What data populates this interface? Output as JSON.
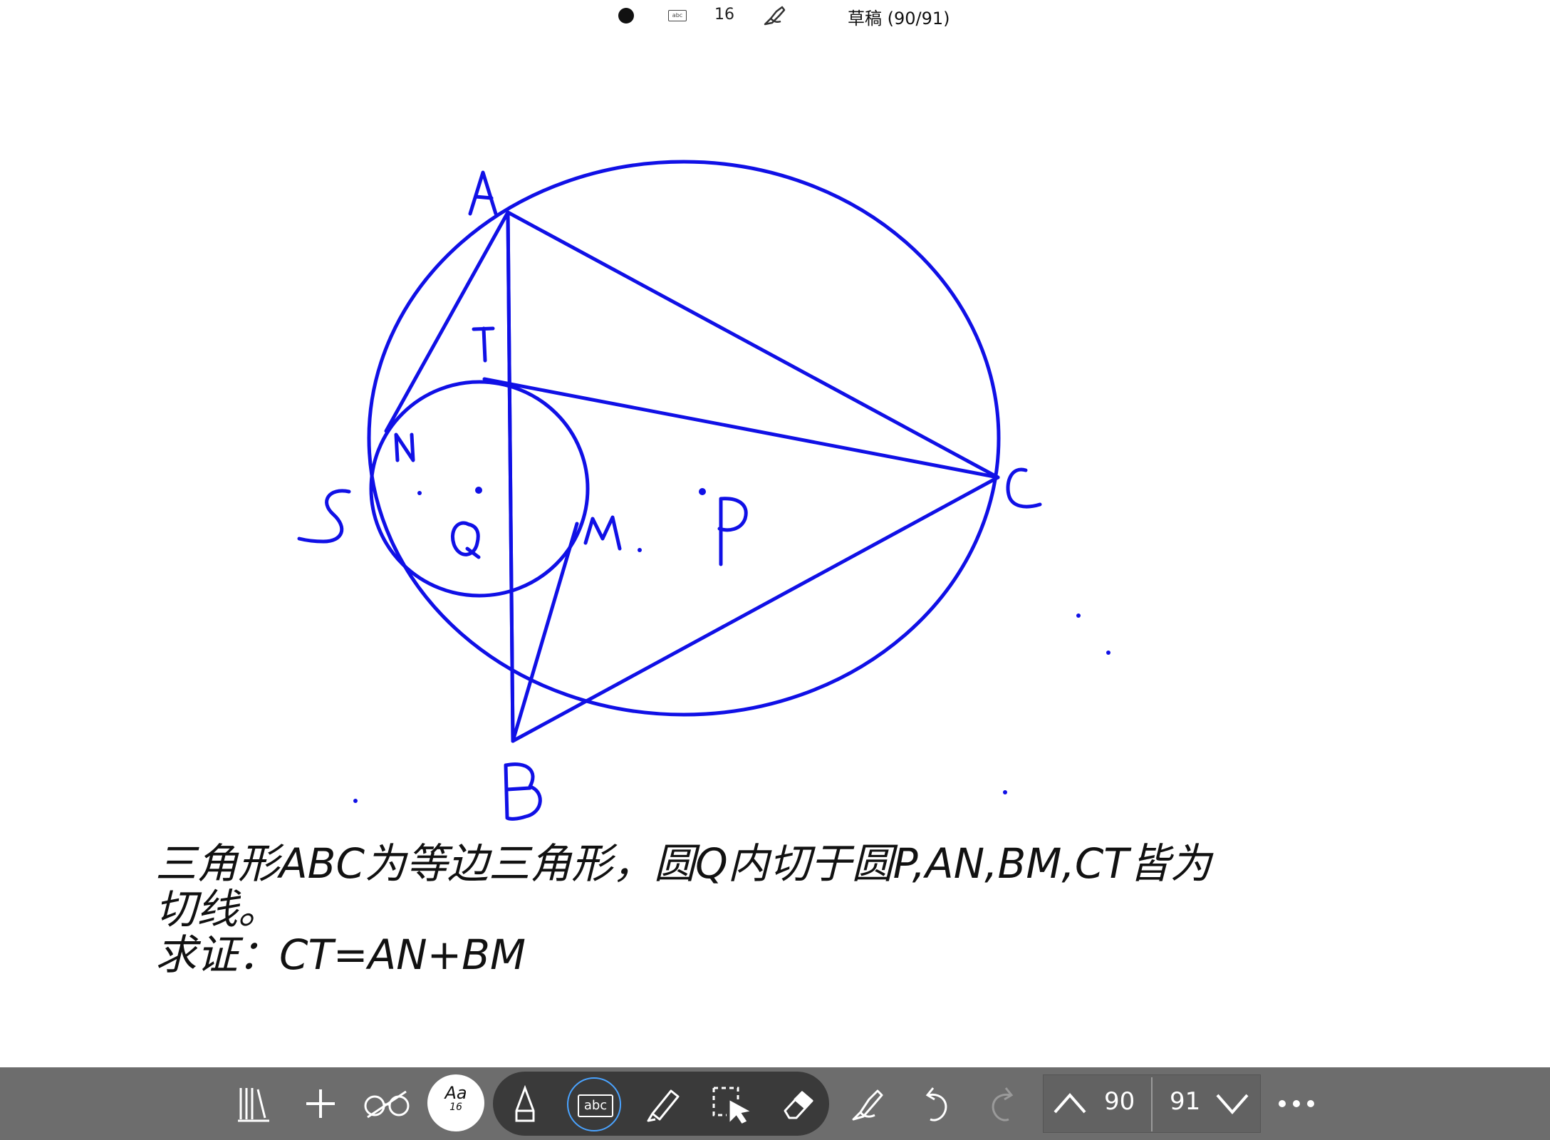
{
  "status_bar": {
    "font_size": "16",
    "title": "草稿 (90/91)"
  },
  "figure": {
    "labels": {
      "A": "A",
      "B": "B",
      "C": "C",
      "T": "T",
      "N": "N",
      "S": "S",
      "Q": "Q",
      "M": "M.",
      "P": "P"
    },
    "stroke_color": "#1010e6"
  },
  "problem": {
    "line1": "三角形ABC为等边三角形，圆Q内切于圆P,AN,BM,CT皆为",
    "line2": "切线。",
    "line3": "求证：CT=AN+BM"
  },
  "toolbar": {
    "font_button_label": "Aa",
    "font_button_size": "16",
    "text_tool_label": "abc",
    "current_page": "90",
    "total_page": "91",
    "icons": [
      "library-icon",
      "add-icon",
      "view-icon",
      "font-icon",
      "pen-icon",
      "text-icon",
      "highlighter-icon",
      "lasso-select-icon",
      "eraser-icon",
      "ink-to-shape-icon",
      "undo-icon",
      "redo-icon",
      "page-up-icon",
      "page-down-icon",
      "more-icon"
    ]
  }
}
